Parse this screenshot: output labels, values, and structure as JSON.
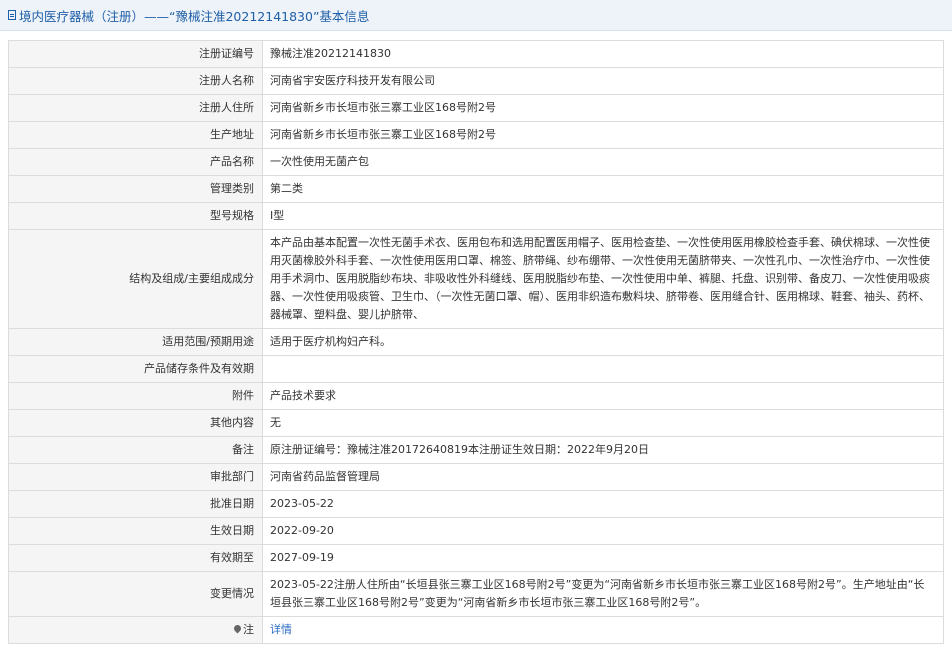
{
  "header": {
    "title": "境内医疗器械（注册）——“豫械注准20212141830”基本信息"
  },
  "rows": [
    {
      "label": "注册证编号",
      "value": "豫械注准20212141830"
    },
    {
      "label": "注册人名称",
      "value": "河南省宇安医疗科技开发有限公司"
    },
    {
      "label": "注册人住所",
      "value": "河南省新乡市长垣市张三寨工业区168号附2号"
    },
    {
      "label": "生产地址",
      "value": "河南省新乡市长垣市张三寨工业区168号附2号"
    },
    {
      "label": "产品名称",
      "value": "一次性使用无菌产包"
    },
    {
      "label": "管理类别",
      "value": "第二类"
    },
    {
      "label": "型号规格",
      "value": "Ⅰ型"
    },
    {
      "label": "结构及组成/主要组成成分",
      "value": "本产品由基本配置一次性无菌手术衣、医用包布和选用配置医用帽子、医用检查垫、一次性使用医用橡胶检查手套、碘伏棉球、一次性使用灭菌橡胶外科手套、一次性使用医用口罩、棉签、脐带绳、纱布绷带、一次性使用无菌脐带夹、一次性孔巾、一次性治疗巾、一次性使用手术洞巾、医用脱脂纱布块、非吸收性外科缝线、医用脱脂纱布垫、一次性使用中单、裤腿、托盘、识别带、备皮刀、一次性使用吸痰器、一次性使用吸痰管、卫生巾、（一次性无菌口罩、帽）、医用非织造布敷料块、脐带卷、医用缝合针、医用棉球、鞋套、袖头、药杯、器械罩、塑料盘、婴儿护脐带、"
    },
    {
      "label": "适用范围/预期用途",
      "value": "适用于医疗机构妇产科。"
    },
    {
      "label": "产品储存条件及有效期",
      "value": ""
    },
    {
      "label": "附件",
      "value": "产品技术要求"
    },
    {
      "label": "其他内容",
      "value": "无"
    },
    {
      "label": "备注",
      "value": "原注册证编号：豫械注准20172640819本注册证生效日期：2022年9月20日"
    },
    {
      "label": "审批部门",
      "value": "河南省药品监督管理局"
    },
    {
      "label": "批准日期",
      "value": "2023-05-22"
    },
    {
      "label": "生效日期",
      "value": "2022-09-20"
    },
    {
      "label": "有效期至",
      "value": "2027-09-19"
    },
    {
      "label": "变更情况",
      "value": "2023-05-22注册人住所由“长垣县张三寨工业区168号附2号”变更为“河南省新乡市长垣市张三寨工业区168号附2号”。生产地址由“长垣县张三寨工业区168号附2号”变更为“河南省新乡市长垣市张三寨工业区168号附2号”。"
    }
  ],
  "note": {
    "label": "注",
    "link_text": "详情"
  },
  "colors": {
    "accent": "#1f5fa8",
    "label_bg": "#f5f5f5",
    "border": "#dcdcdc",
    "link": "#2a6bc4"
  }
}
